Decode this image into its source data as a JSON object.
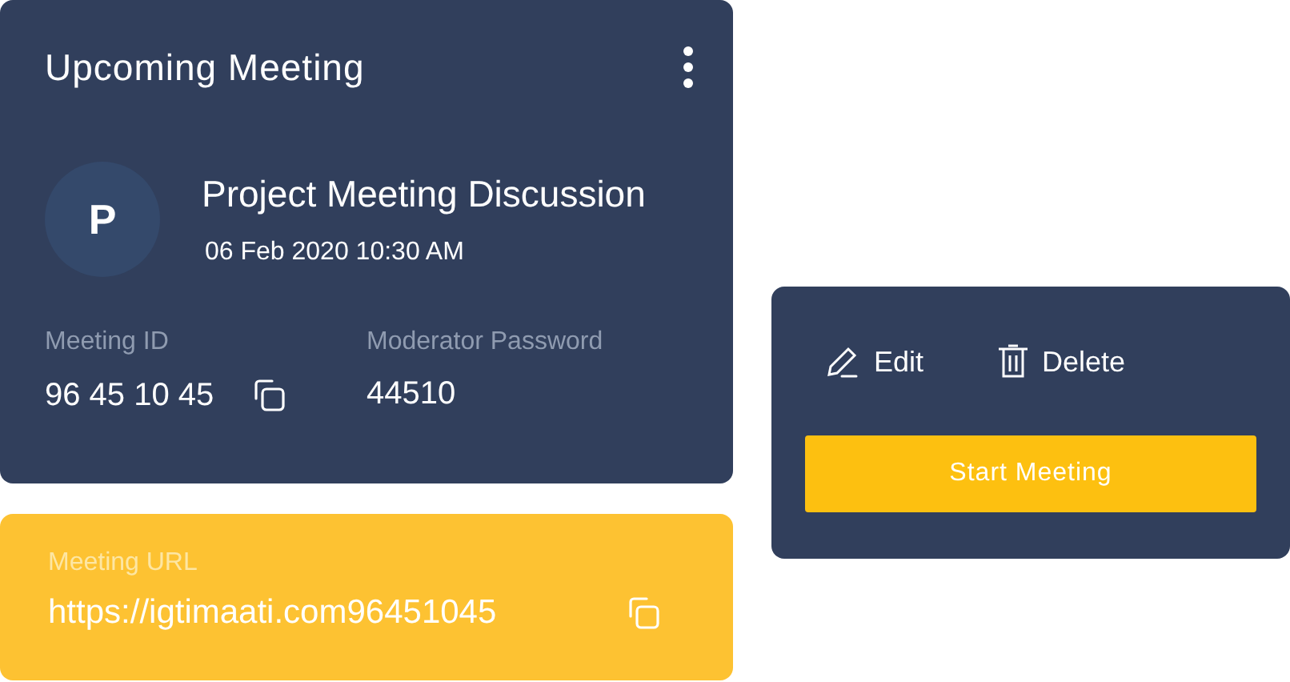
{
  "meeting_card": {
    "title": "Upcoming Meeting",
    "avatar_letter": "P",
    "name": "Project Meeting Discussion",
    "datetime": "06 Feb 2020 10:30 AM",
    "fields": [
      {
        "label": "Meeting ID",
        "value": "96 45 10 45",
        "copyable": true
      },
      {
        "label": "Moderator Password",
        "value": "44510",
        "copyable": false
      }
    ]
  },
  "url_card": {
    "label": "Meeting URL",
    "value": "https://igtimaati.com96451045"
  },
  "actions": [
    {
      "kind": "edit",
      "label": "Edit"
    },
    {
      "kind": "delete",
      "label": "Delete"
    }
  ],
  "start_button": "Start Meeting"
}
